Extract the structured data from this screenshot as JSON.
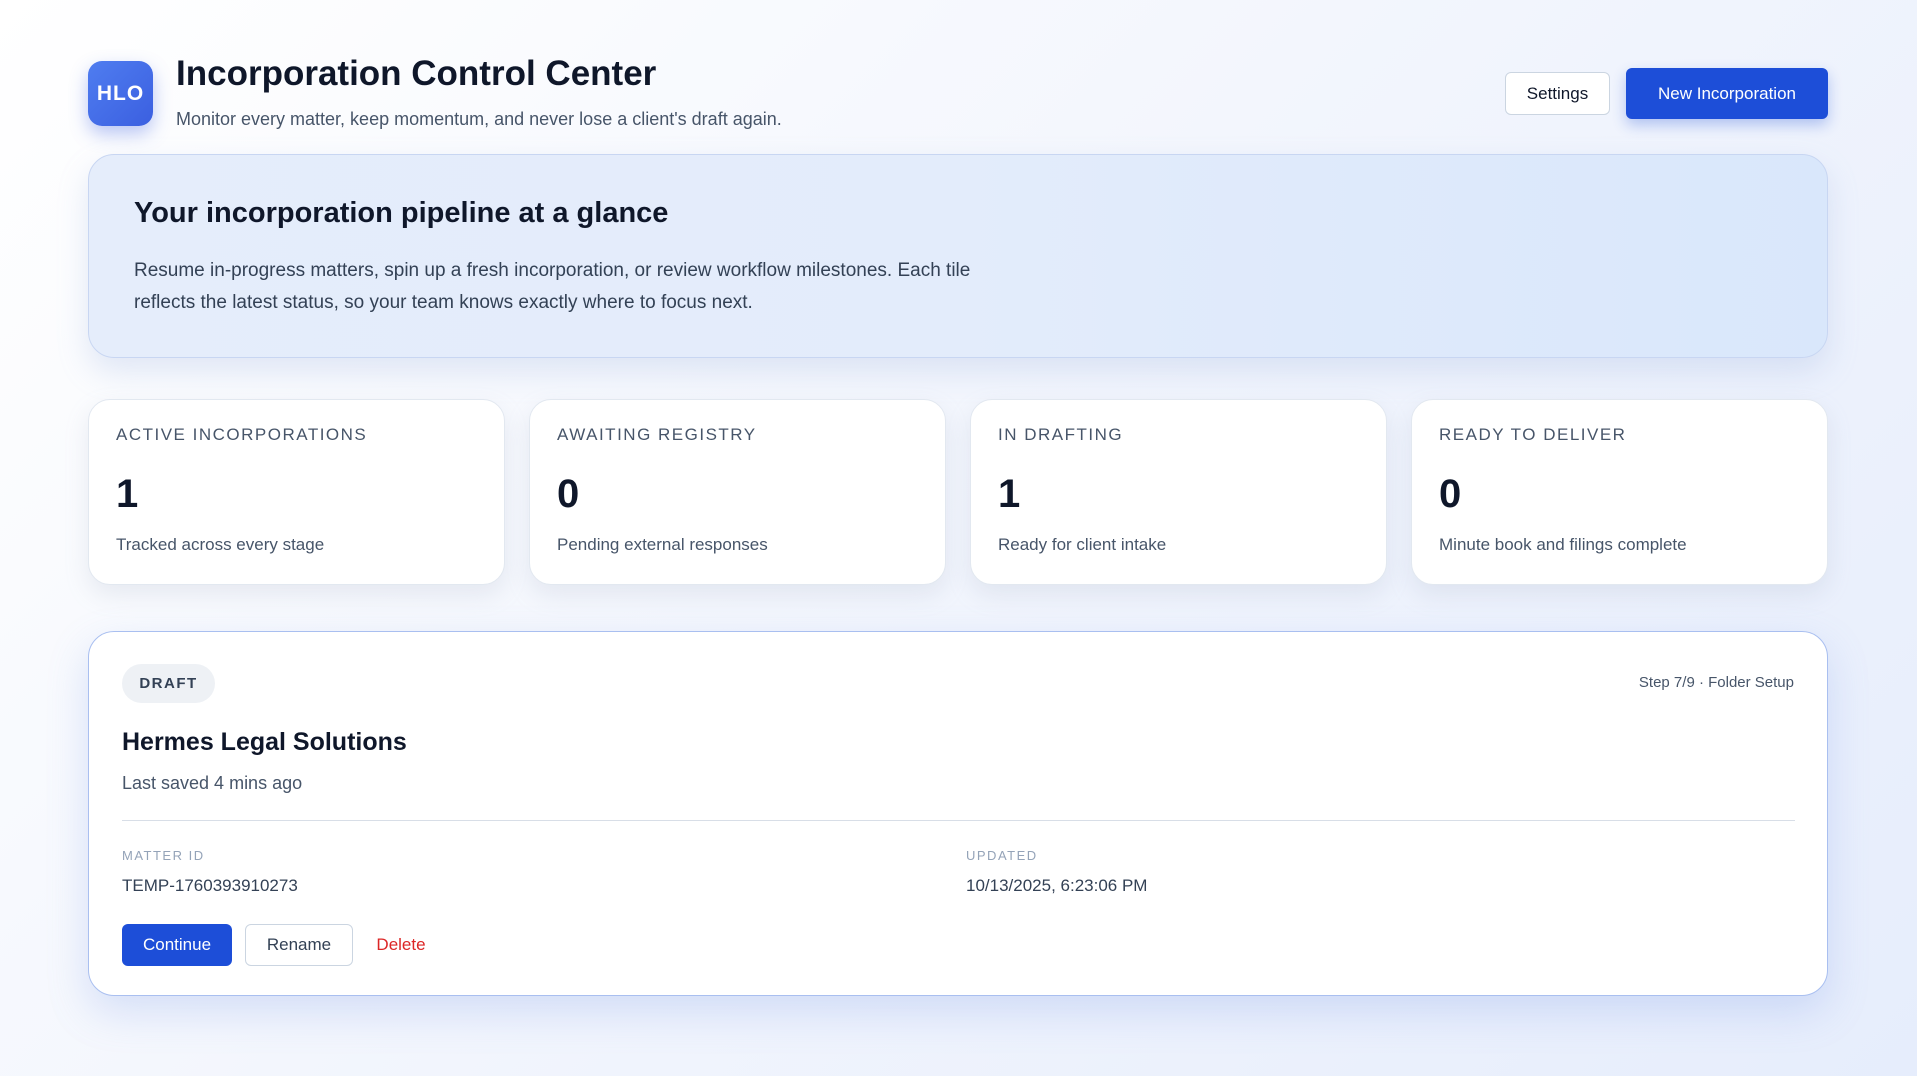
{
  "header": {
    "logo_text": "HLO",
    "title": "Incorporation Control Center",
    "subtitle": "Monitor every matter, keep momentum, and never lose a client's draft again.",
    "settings_label": "Settings",
    "new_label": "New Incorporation"
  },
  "hero": {
    "title": "Your incorporation pipeline at a glance",
    "text": "Resume in-progress matters, spin up a fresh incorporation, or review workflow milestones. Each tile reflects the latest status, so your team knows exactly where to focus next."
  },
  "stats": [
    {
      "label": "ACTIVE INCORPORATIONS",
      "value": "1",
      "desc": "Tracked across every stage"
    },
    {
      "label": "AWAITING REGISTRY",
      "value": "0",
      "desc": "Pending external responses"
    },
    {
      "label": "IN DRAFTING",
      "value": "1",
      "desc": "Ready for client intake"
    },
    {
      "label": "READY TO DELIVER",
      "value": "0",
      "desc": "Minute book and filings complete"
    }
  ],
  "matter": {
    "badge": "DRAFT",
    "step": "Step 7/9 · Folder Setup",
    "name": "Hermes Legal Solutions",
    "saved": "Last saved 4 mins ago",
    "matter_id_label": "MATTER ID",
    "matter_id": "TEMP-1760393910273",
    "updated_label": "UPDATED",
    "updated": "10/13/2025, 6:23:06 PM",
    "continue_label": "Continue",
    "rename_label": "Rename",
    "delete_label": "Delete"
  },
  "colors": {
    "accent": "#1d4ed8",
    "danger": "#dc2626",
    "logo_gradient_start": "#4f7df0",
    "logo_gradient_end": "#3b5fe0"
  }
}
